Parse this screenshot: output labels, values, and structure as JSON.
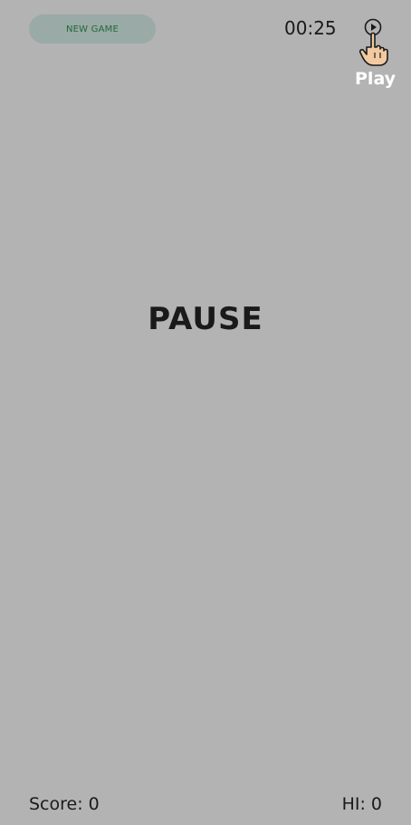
{
  "header": {
    "new_game_label": "NEW GAME",
    "timer": "00:25",
    "play_label": "Play"
  },
  "main": {
    "status": "PAUSE"
  },
  "footer": {
    "score": "Score: 0",
    "hi_score": "HI: 0"
  },
  "icons": {
    "play": "play-circle-icon",
    "hand": "pointing-hand-icon"
  },
  "colors": {
    "background": "#b3b3b3",
    "new_game_bg": "#9aaaa6",
    "new_game_text": "#1f6b3a",
    "text": "#1a1a1a",
    "play_label": "#ffffff"
  }
}
